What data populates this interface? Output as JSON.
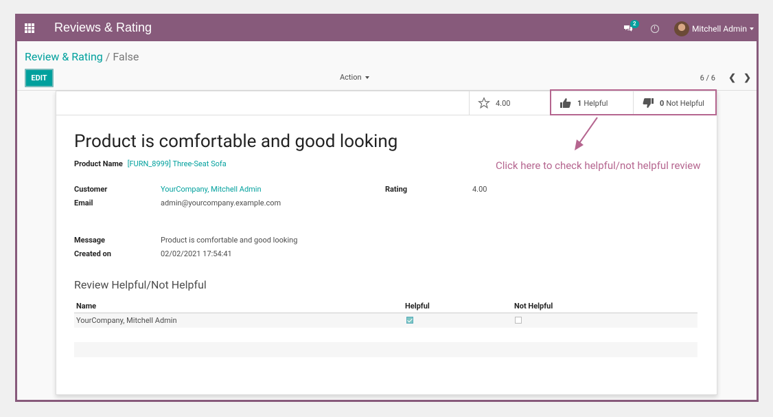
{
  "navbar": {
    "app_title": "Reviews & Rating",
    "chat_count": "2",
    "user_name": "Mitchell Admin"
  },
  "breadcrumb": {
    "parent": "Review & Rating",
    "separator": "/",
    "current": "False"
  },
  "toolbar": {
    "edit_label": "EDIT",
    "action_label": "Action",
    "pager": "6 / 6"
  },
  "stats": {
    "rating_value": "4.00",
    "helpful_count": "1",
    "helpful_label": "Helpful",
    "not_helpful_count": "0",
    "not_helpful_label": "Not Helpful"
  },
  "annotation": "Click here to check helpful/not helpful review",
  "record": {
    "title": "Product is comfortable and good looking",
    "product_label": "Product Name",
    "product_value": "[FURN_8999] Three-Seat Sofa",
    "customer_label": "Customer",
    "customer_value": "YourCompany, Mitchell Admin",
    "email_label": "Email",
    "email_value": "admin@yourcompany.example.com",
    "rating_label": "Rating",
    "rating_value": "4.00",
    "message_label": "Message",
    "message_value": "Product is comfortable and good looking",
    "created_label": "Created on",
    "created_value": "02/02/2021 17:54:41"
  },
  "helpful_section": {
    "title": "Review Helpful/Not Helpful",
    "columns": [
      "Name",
      "Helpful",
      "Not Helpful"
    ],
    "rows": [
      {
        "name": "YourCompany, Mitchell Admin",
        "helpful": true,
        "not_helpful": false
      }
    ]
  },
  "colors": {
    "brand": "#875a7b",
    "accent": "#00a09d",
    "annotation": "#b5658f"
  }
}
